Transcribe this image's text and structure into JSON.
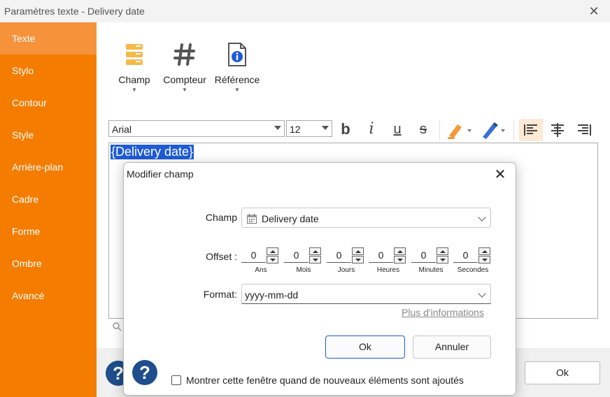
{
  "window": {
    "title": "Paramètres texte - Delivery date",
    "close_glyph": "✕"
  },
  "sidebar": {
    "items": [
      {
        "label": "Texte",
        "active": true
      },
      {
        "label": "Stylo"
      },
      {
        "label": "Contour"
      },
      {
        "label": "Style"
      },
      {
        "label": "Arrière-plan"
      },
      {
        "label": "Cadre"
      },
      {
        "label": "Forme"
      },
      {
        "label": "Ombre"
      },
      {
        "label": "Avancé"
      }
    ]
  },
  "ribbon": {
    "champ": "Champ",
    "compteur": "Compteur",
    "reference": "Référence",
    "caret": "▼"
  },
  "format_bar": {
    "font": "Arial",
    "size": "12",
    "bold": "b",
    "italic": "i",
    "underline": "u",
    "strike": "s"
  },
  "editor": {
    "selected_text": "{Delivery date}"
  },
  "outer_footer": {
    "help": "?",
    "ok_label": "Ok"
  },
  "modal": {
    "title": "Modifier champ",
    "close_glyph": "✕",
    "champ_label": "Champ",
    "champ_value": "Delivery date",
    "offset_label": "Offset :",
    "offsets": [
      {
        "value": "0",
        "caption": "Ans"
      },
      {
        "value": "0",
        "caption": "Mois"
      },
      {
        "value": "0",
        "caption": "Jours"
      },
      {
        "value": "0",
        "caption": "Heures"
      },
      {
        "value": "0",
        "caption": "Minutes"
      },
      {
        "value": "0",
        "caption": "Secondes"
      }
    ],
    "format_label": "Format:",
    "format_value": "yyyy-mm-dd",
    "more_info": "Plus d'informations",
    "ok_label": "Ok",
    "cancel_label": "Annuler",
    "help": "?",
    "show_checkbox_label": "Montrer cette fenêtre quand de nouveaux éléments sont ajoutés",
    "show_checkbox_checked": false
  },
  "colors": {
    "sidebar": "#f47c00",
    "sidebar_active": "#f5923a",
    "selection": "#1e5bd6",
    "help": "#1e4e8c",
    "field_icon": "#f5b84a",
    "counter_icon": "#555555",
    "reference_icon": "#1e5bd6",
    "highlighter": "#f39a3a",
    "pen": "#3a6fd6"
  }
}
